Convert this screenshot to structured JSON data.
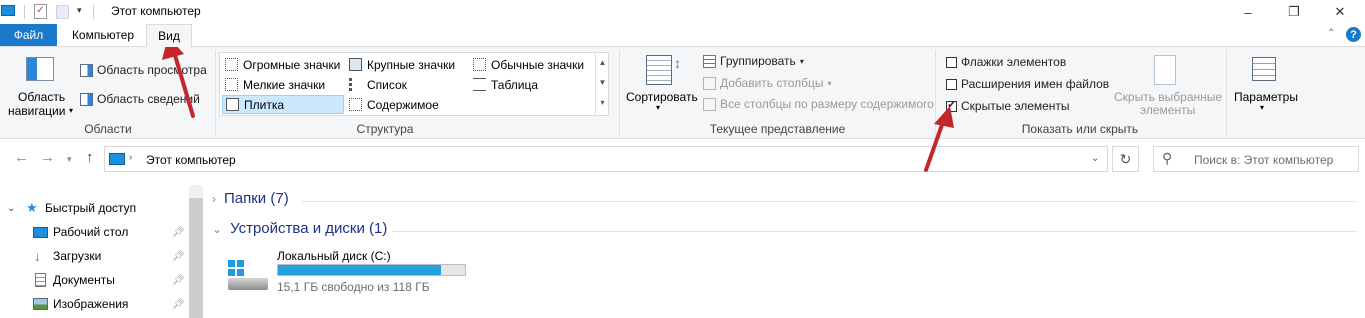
{
  "window": {
    "title": "Этот компьютер",
    "controls": [
      "–",
      "❐",
      "✕"
    ]
  },
  "tabs": {
    "file": "Файл",
    "computer": "Компьютер",
    "view": "Вид"
  },
  "ribbon": {
    "panels_group": {
      "nav_pane": "Область навигации",
      "nav_pane_line1": "Область",
      "nav_pane_line2": "навигации",
      "preview_pane": "Область просмотра",
      "details_pane": "Область сведений",
      "label": "Области"
    },
    "layout_group": {
      "items": [
        "Огромные значки",
        "Крупные значки",
        "Обычные значки",
        "Мелкие значки",
        "Список",
        "Таблица",
        "Плитка",
        "Содержимое"
      ],
      "selected": "Плитка",
      "label": "Структура"
    },
    "current_view_group": {
      "sort_by": "Сортировать",
      "group_by": "Группировать",
      "add_columns": "Добавить столбцы",
      "size_columns": "Все столбцы по размеру содержимого",
      "label": "Текущее представление"
    },
    "show_hide_group": {
      "item_checkboxes": "Флажки элементов",
      "file_extensions": "Расширения имен файлов",
      "hidden_items": "Скрытые элементы",
      "hidden_items_checked": true,
      "hide_selected_line1": "Скрыть выбранные",
      "hide_selected_line2": "элементы",
      "label": "Показать или скрыть"
    },
    "options": "Параметры"
  },
  "address": {
    "path": "Этот компьютер",
    "search_placeholder": "Поиск в: Этот компьютер"
  },
  "nav_pane": {
    "quick_access": "Быстрый доступ",
    "items": [
      "Рабочий стол",
      "Загрузки",
      "Документы",
      "Изображения"
    ]
  },
  "content": {
    "folders_section": "Папки (7)",
    "devices_section": "Устройства и диски (1)",
    "drive": {
      "name": "Локальный диск (C:)",
      "free_text": "15,1 ГБ свободно из 118 ГБ",
      "used_fraction": 0.872
    }
  },
  "colors": {
    "accent": "#1979ca",
    "bar_fill": "#26a0da",
    "annotation_arrow": "#c1272d"
  }
}
